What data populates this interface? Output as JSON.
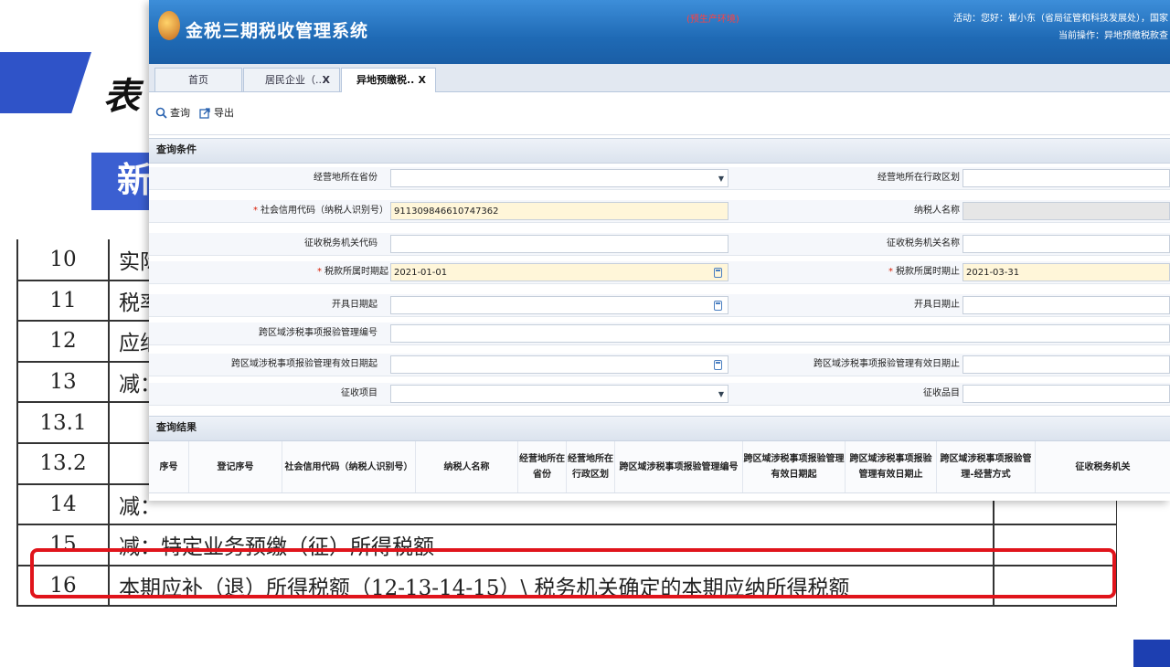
{
  "slide": {
    "title": "表",
    "subtitle": "新",
    "rows": [
      {
        "num": "10",
        "text": "实际"
      },
      {
        "num": "11",
        "text": "税率"
      },
      {
        "num": "12",
        "text": "应纳"
      },
      {
        "num": "13",
        "text": "减："
      },
      {
        "num": "13.1",
        "text": ""
      },
      {
        "num": "13.2",
        "text": ""
      },
      {
        "num": "14",
        "text": "减："
      },
      {
        "num": "15",
        "text": "减：特定业务预缴（征）所得税额"
      },
      {
        "num": "16",
        "text": "本期应补（退）所得税额（12-13-14-15）\\ 税务机关确定的本期应纳所得税额"
      }
    ],
    "highlight_color": "#e0141b"
  },
  "app": {
    "title": "金税三期税收管理系统",
    "env_tag": "(预生产环境)",
    "user_info": "活动：您好：崔小东（省局征管和科技发展处），国家",
    "current_operation": "当前操作：异地预缴税款查",
    "tabs": [
      {
        "label": "首页",
        "closable": false,
        "active": false
      },
      {
        "label": "居民企业（..",
        "closable": true,
        "active": false
      },
      {
        "label": "异地预缴税..",
        "closable": true,
        "active": true
      }
    ],
    "tab_close": "X",
    "toolbar": {
      "query": "查询",
      "export": "导出"
    },
    "query_section": "查询条件",
    "result_section": "查询结果",
    "form": {
      "province_label": "经营地所在省份",
      "province_value": "",
      "district_label": "经营地所在行政区划",
      "district_value": "",
      "credit_code_label": "社会信用代码（纳税人识别号）",
      "credit_code_value": "911309846610747362",
      "taxpayer_name_label": "纳税人名称",
      "taxpayer_name_value": "",
      "tax_office_code_label": "征收税务机关代码",
      "tax_office_code_value": "",
      "tax_office_name_label": "征收税务机关名称",
      "tax_office_name_value": "",
      "period_start_label": "税款所属时期起",
      "period_start_value": "2021-01-01",
      "period_end_label": "税款所属时期止",
      "period_end_value": "2021-03-31",
      "issue_start_label": "开具日期起",
      "issue_start_value": "",
      "issue_end_label": "开具日期止",
      "issue_end_value": "",
      "cross_reg_no_label": "跨区域涉税事项报验管理编号",
      "cross_reg_no_value": "",
      "valid_start_label": "跨区域涉税事项报验管理有效日期起",
      "valid_start_value": "",
      "valid_end_label": "跨区域涉税事项报验管理有效日期止",
      "valid_end_value": "",
      "levy_item_label": "征收项目",
      "levy_item_value": "",
      "levy_subitem_label": "征收品目",
      "levy_subitem_value": ""
    },
    "result_columns": [
      "序号",
      "登记序号",
      "社会信用代码（纳税人识别号）",
      "纳税人名称",
      "经营地所在省份",
      "经营地所在行政区划",
      "跨区域涉税事项报验管理编号",
      "跨区域涉税事项报验管理有效日期起",
      "跨区域涉税事项报验管理有效日期止",
      "跨区域涉税事项报验管理-经营方式",
      "征收税务机关"
    ]
  }
}
